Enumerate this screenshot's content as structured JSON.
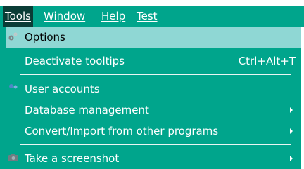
{
  "menubar": {
    "items": [
      {
        "label": "Tools",
        "mnemonic_index": 0
      },
      {
        "label": "Window",
        "mnemonic_index": 0
      },
      {
        "label": "Help",
        "mnemonic_index": 0
      },
      {
        "label": "Test",
        "mnemonic_index": 0
      }
    ]
  },
  "tools_menu": {
    "options_label": "Options",
    "deactivate_tooltips_label": "Deactivate tooltips",
    "deactivate_tooltips_shortcut": "Ctrl+Alt+T",
    "user_accounts_label": "User accounts",
    "database_management_label": "Database management",
    "convert_import_label": "Convert/Import from other programs",
    "take_screenshot_label": "Take a screenshot"
  },
  "colors": {
    "menu_background": "#00a58c",
    "active_menubar_background": "#0a3d36",
    "selected_item_background": "#8fd7d4",
    "text_light": "#ffffff",
    "text_dark": "#000000"
  },
  "icons": {
    "options": "gears-icon",
    "user_accounts": "users-icon",
    "take_screenshot": "camera-icon"
  }
}
